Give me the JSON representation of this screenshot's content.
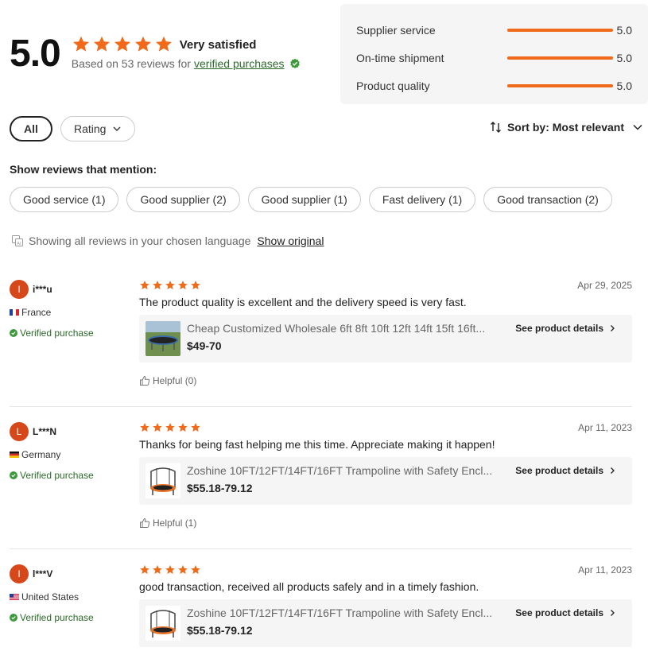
{
  "summary": {
    "score": "5.0",
    "rating_stars": 5,
    "satisfaction_label": "Very satisfied",
    "based_on_prefix": "Based on 53 reviews for",
    "verified_link": "verified purchases"
  },
  "scores": [
    {
      "label": "Supplier service",
      "value": "5.0",
      "fill_fraction": 1.0
    },
    {
      "label": "On-time shipment",
      "value": "5.0",
      "fill_fraction": 1.0
    },
    {
      "label": "Product quality",
      "value": "5.0",
      "fill_fraction": 1.0
    }
  ],
  "filters": {
    "all_label": "All",
    "rating_label": "Rating"
  },
  "sort": {
    "label": "Sort by: Most relevant"
  },
  "mentions": {
    "title": "Show reviews that mention:",
    "tags": [
      "Good service (1)",
      "Good supplier (2)",
      "Good supplier (1)",
      "Fast delivery (1)",
      "Good transaction (2)"
    ]
  },
  "language": {
    "notice": "Showing all reviews in your chosen language",
    "show_original": "Show original"
  },
  "colors": {
    "accent": "#f06a1a",
    "verified_green": "#2c6a2a",
    "avatar_bg": "#d6481a"
  },
  "reviews": [
    {
      "initial": "I",
      "name": "i***u",
      "country": "France",
      "flag": "flag-fr",
      "verified": "Verified purchase",
      "stars": 5,
      "date": "Apr 29, 2025",
      "text": "The product quality is excellent and the delivery speed is very fast.",
      "product_title": "Cheap Customized Wholesale 6ft 8ft 10ft 12ft 14ft 15ft 16ft...",
      "product_price": "$49-70",
      "product_thumb": "trampoline-outdoor-icon",
      "see_details": "See product details",
      "helpful": "Helpful (0)"
    },
    {
      "initial": "L",
      "name": "L***N",
      "country": "Germany",
      "flag": "flag-de",
      "verified": "Verified purchase",
      "stars": 5,
      "date": "Apr 11, 2023",
      "text": "Thanks for being fast helping me this time. Appreciate making it happen!",
      "product_title": "Zoshine 10FT/12FT/14FT/16FT Trampoline with Safety Encl...",
      "product_price": "$55.18-79.12",
      "product_thumb": "trampoline-enclosure-icon",
      "see_details": "See product details",
      "helpful": "Helpful (1)"
    },
    {
      "initial": "I",
      "name": "l***V",
      "country": "United States",
      "flag": "flag-us",
      "verified": "Verified purchase",
      "stars": 5,
      "date": "Apr 11, 2023",
      "text": "good transaction, received all products safely and in a timely fashion.",
      "product_title": "Zoshine 10FT/12FT/14FT/16FT Trampoline with Safety Encl...",
      "product_price": "$55.18-79.12",
      "product_thumb": "trampoline-enclosure-icon",
      "see_details": "See product details",
      "helpful": ""
    }
  ]
}
